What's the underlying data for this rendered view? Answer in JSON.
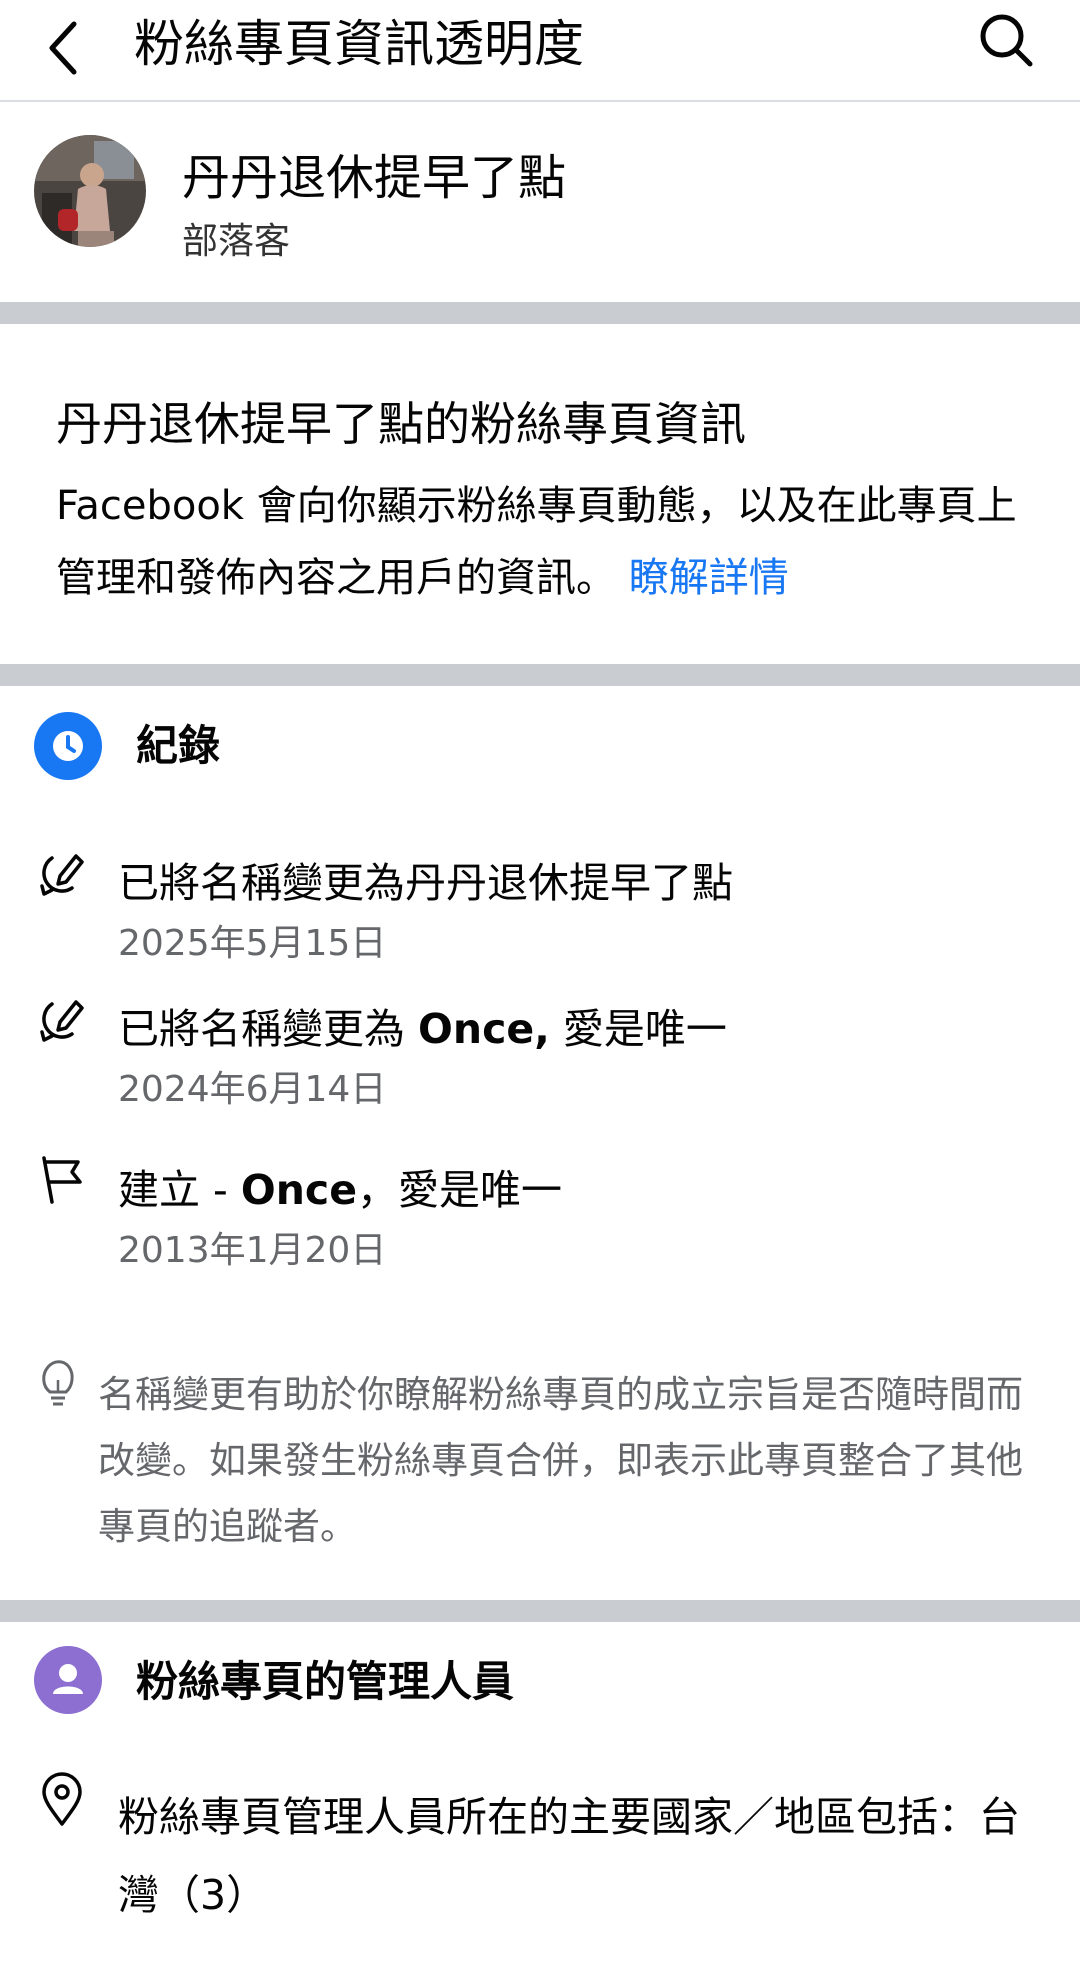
{
  "header": {
    "title": "粉絲專頁資訊透明度",
    "back_icon": "chevron-left-icon",
    "search_icon": "search-icon"
  },
  "profile": {
    "name": "丹丹退休提早了點",
    "category": "部落客"
  },
  "intro": {
    "title": "丹丹退休提早了點的粉絲專頁資訊",
    "body": "Facebook 會向你顯示粉絲專頁動態，以及在此專頁上管理和發佈內容之用戶的資訊。",
    "link": "瞭解詳情"
  },
  "history": {
    "title": "紀錄",
    "icon": "clock-icon",
    "items": [
      {
        "icon": "edit-name-icon",
        "text_plain": "已將名稱變更為丹丹退休提早了點",
        "text_bold": "",
        "text_after": "",
        "date": "2025年5月15日"
      },
      {
        "icon": "edit-name-icon",
        "text_plain": "已將名稱變更為 ",
        "text_bold": "Once,",
        "text_after": " 愛是唯一",
        "date": "2024年6月14日"
      },
      {
        "icon": "flag-icon",
        "text_plain": "建立 - ",
        "text_bold": "Once",
        "text_after": "，愛是唯一",
        "date": "2013年1月20日"
      }
    ],
    "note": "名稱變更有助於你瞭解粉絲專頁的成立宗旨是否隨時間而改變。如果發生粉絲專頁合併，即表示此專頁整合了其他專頁的追蹤者。",
    "note_icon": "lightbulb-icon"
  },
  "managers": {
    "title": "粉絲專頁的管理人員",
    "icon": "person-icon",
    "location_icon": "location-pin-icon",
    "location_text": "粉絲專頁管理人員所在的主要國家／地區包括：台灣（3）"
  },
  "colors": {
    "link": "#1877f2",
    "clock_badge": "#1877f2",
    "person_badge": "#8c6fd1",
    "divider": "#c9ccd1"
  }
}
